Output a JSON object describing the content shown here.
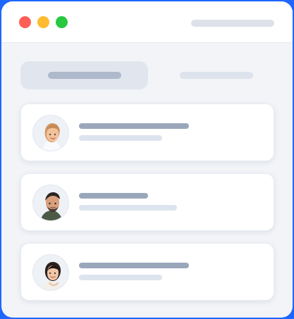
{
  "window": {
    "title": "",
    "controls": [
      {
        "name": "close",
        "color": "#ff5f57"
      },
      {
        "name": "minimize",
        "color": "#febc2e"
      },
      {
        "name": "zoom",
        "color": "#28c840"
      }
    ]
  },
  "tabs": [
    {
      "name": "tab-1",
      "label": "",
      "active": true
    },
    {
      "name": "tab-2",
      "label": "",
      "active": false
    }
  ],
  "list": {
    "items": [
      {
        "name": "profile-1",
        "avatar": "user-avatar-woman-light-hair",
        "title": "",
        "subtitle": ""
      },
      {
        "name": "profile-2",
        "avatar": "user-avatar-man-dark-hair",
        "title": "",
        "subtitle": ""
      },
      {
        "name": "profile-3",
        "avatar": "user-avatar-woman-dark-hair",
        "title": "",
        "subtitle": ""
      }
    ]
  },
  "colors": {
    "background": "#1f66ff",
    "window": "#f2f4f8",
    "card": "#ffffff",
    "placeholder_dark": "#9aa7bb",
    "placeholder_light": "#dde4ee"
  }
}
